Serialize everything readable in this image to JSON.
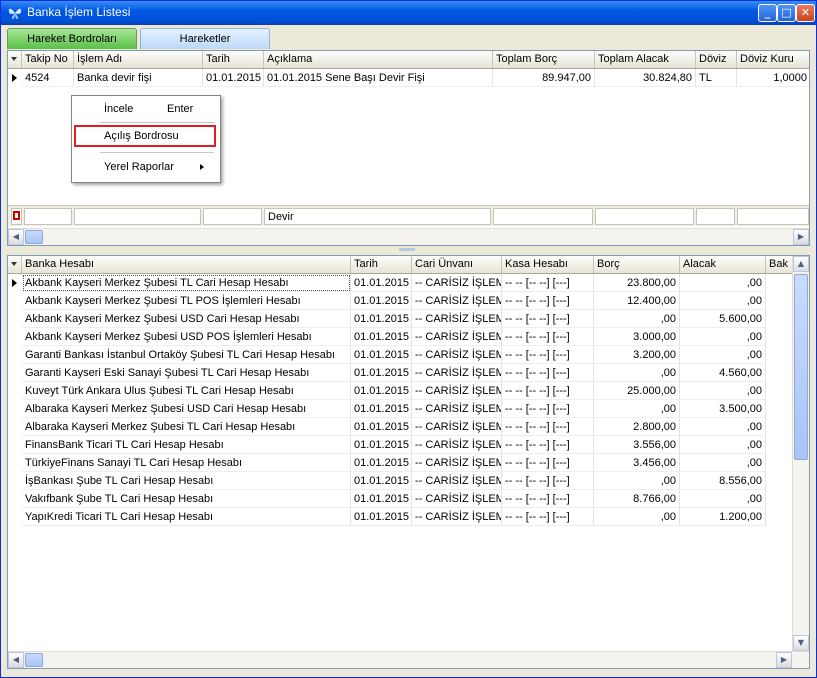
{
  "window": {
    "title": "Banka İşlem Listesi",
    "min_label": "_",
    "max_label": "□",
    "close_label": "✕"
  },
  "tabs": [
    {
      "label": "Hareket Bordroları"
    },
    {
      "label": "Hareketler"
    }
  ],
  "top_grid": {
    "columns": [
      "Takip No",
      "İşlem Adı",
      "Tarih",
      "Açıklama",
      "Toplam Borç",
      "Toplam Alacak",
      "Döviz",
      "Döviz Kuru"
    ],
    "rows": [
      {
        "takip_no": "4524",
        "islem_adi": "Banka devir fişi",
        "tarih": "01.01.2015",
        "aciklama": "01.01.2015 Sene Başı Devir Fişi",
        "toplam_borc": "89.947,00",
        "toplam_alacak": "30.824,80",
        "doviz": "TL",
        "doviz_kuru": "1,0000"
      }
    ],
    "footer_aciklama": "Devir"
  },
  "context_menu": {
    "items": [
      {
        "label": "İncele",
        "shortcut": "Enter"
      },
      {
        "label": "Açılış Bordrosu",
        "shortcut": ""
      },
      {
        "label": "Yerel Raporlar",
        "shortcut": ""
      }
    ]
  },
  "bottom_grid": {
    "columns": [
      "Banka Hesabı",
      "Tarih",
      "Cari Ünvanı",
      "Kasa Hesabı",
      "Borç",
      "Alacak",
      "Bak"
    ],
    "rows": [
      {
        "hesap": "Akbank Kayseri Merkez Şubesi TL Cari Hesap Hesabı",
        "tarih": "01.01.2015",
        "cari": "-- CARİSİZ İŞLEM",
        "kasa": "-- -- [-- --] [---]",
        "borc": "23.800,00",
        "alacak": ",00"
      },
      {
        "hesap": "Akbank Kayseri Merkez Şubesi TL POS İşlemleri Hesabı",
        "tarih": "01.01.2015",
        "cari": "-- CARİSİZ İŞLEM",
        "kasa": "-- -- [-- --] [---]",
        "borc": "12.400,00",
        "alacak": ",00"
      },
      {
        "hesap": "Akbank Kayseri Merkez Şubesi USD Cari Hesap Hesabı",
        "tarih": "01.01.2015",
        "cari": "-- CARİSİZ İŞLEM",
        "kasa": "-- -- [-- --] [---]",
        "borc": ",00",
        "alacak": "5.600,00"
      },
      {
        "hesap": "Akbank Kayseri Merkez Şubesi USD POS İşlemleri Hesabı",
        "tarih": "01.01.2015",
        "cari": "-- CARİSİZ İŞLEM",
        "kasa": "-- -- [-- --] [---]",
        "borc": "3.000,00",
        "alacak": ",00"
      },
      {
        "hesap": "Garanti Bankası İstanbul Ortaköy Şubesi TL Cari Hesap Hesabı",
        "tarih": "01.01.2015",
        "cari": "-- CARİSİZ İŞLEM",
        "kasa": "-- -- [-- --] [---]",
        "borc": "3.200,00",
        "alacak": ",00"
      },
      {
        "hesap": "Garanti Kayseri Eski Sanayi Şubesi TL Cari Hesap Hesabı",
        "tarih": "01.01.2015",
        "cari": "-- CARİSİZ İŞLEM",
        "kasa": "-- -- [-- --] [---]",
        "borc": ",00",
        "alacak": "4.560,00"
      },
      {
        "hesap": "Kuveyt Türk Ankara Ulus Şubesi TL Cari Hesap Hesabı",
        "tarih": "01.01.2015",
        "cari": "-- CARİSİZ İŞLEM",
        "kasa": "-- -- [-- --] [---]",
        "borc": "25.000,00",
        "alacak": ",00"
      },
      {
        "hesap": "Albaraka Kayseri Merkez Şubesi USD Cari Hesap Hesabı",
        "tarih": "01.01.2015",
        "cari": "-- CARİSİZ İŞLEM",
        "kasa": "-- -- [-- --] [---]",
        "borc": ",00",
        "alacak": "3.500,00"
      },
      {
        "hesap": "Albaraka Kayseri Merkez Şubesi TL Cari Hesap Hesabı",
        "tarih": "01.01.2015",
        "cari": "-- CARİSİZ İŞLEM",
        "kasa": "-- -- [-- --] [---]",
        "borc": "2.800,00",
        "alacak": ",00"
      },
      {
        "hesap": "FinansBank Ticari TL Cari Hesap Hesabı",
        "tarih": "01.01.2015",
        "cari": "-- CARİSİZ İŞLEM",
        "kasa": "-- -- [-- --] [---]",
        "borc": "3.556,00",
        "alacak": ",00"
      },
      {
        "hesap": "TürkiyeFinans Sanayi TL Cari Hesap Hesabı",
        "tarih": "01.01.2015",
        "cari": "-- CARİSİZ İŞLEM",
        "kasa": "-- -- [-- --] [---]",
        "borc": "3.456,00",
        "alacak": ",00"
      },
      {
        "hesap": "İşBankası Şube TL Cari Hesap Hesabı",
        "tarih": "01.01.2015",
        "cari": "-- CARİSİZ İŞLEM",
        "kasa": "-- -- [-- --] [---]",
        "borc": ",00",
        "alacak": "8.556,00"
      },
      {
        "hesap": "Vakıfbank Şube TL Cari Hesap Hesabı",
        "tarih": "01.01.2015",
        "cari": "-- CARİSİZ İŞLEM",
        "kasa": "-- -- [-- --] [---]",
        "borc": "8.766,00",
        "alacak": ",00"
      },
      {
        "hesap": "YapıKredi Ticari TL Cari Hesap Hesabı",
        "tarih": "01.01.2015",
        "cari": "-- CARİSİZ İŞLEM",
        "kasa": "-- -- [-- --] [---]",
        "borc": ",00",
        "alacak": "1.200,00"
      }
    ]
  },
  "colors": {
    "title_bar": "#0058e6",
    "active_tab": "#5bbf47",
    "inactive_tab": "#bcd9f7",
    "highlight_border": "#e02020"
  }
}
